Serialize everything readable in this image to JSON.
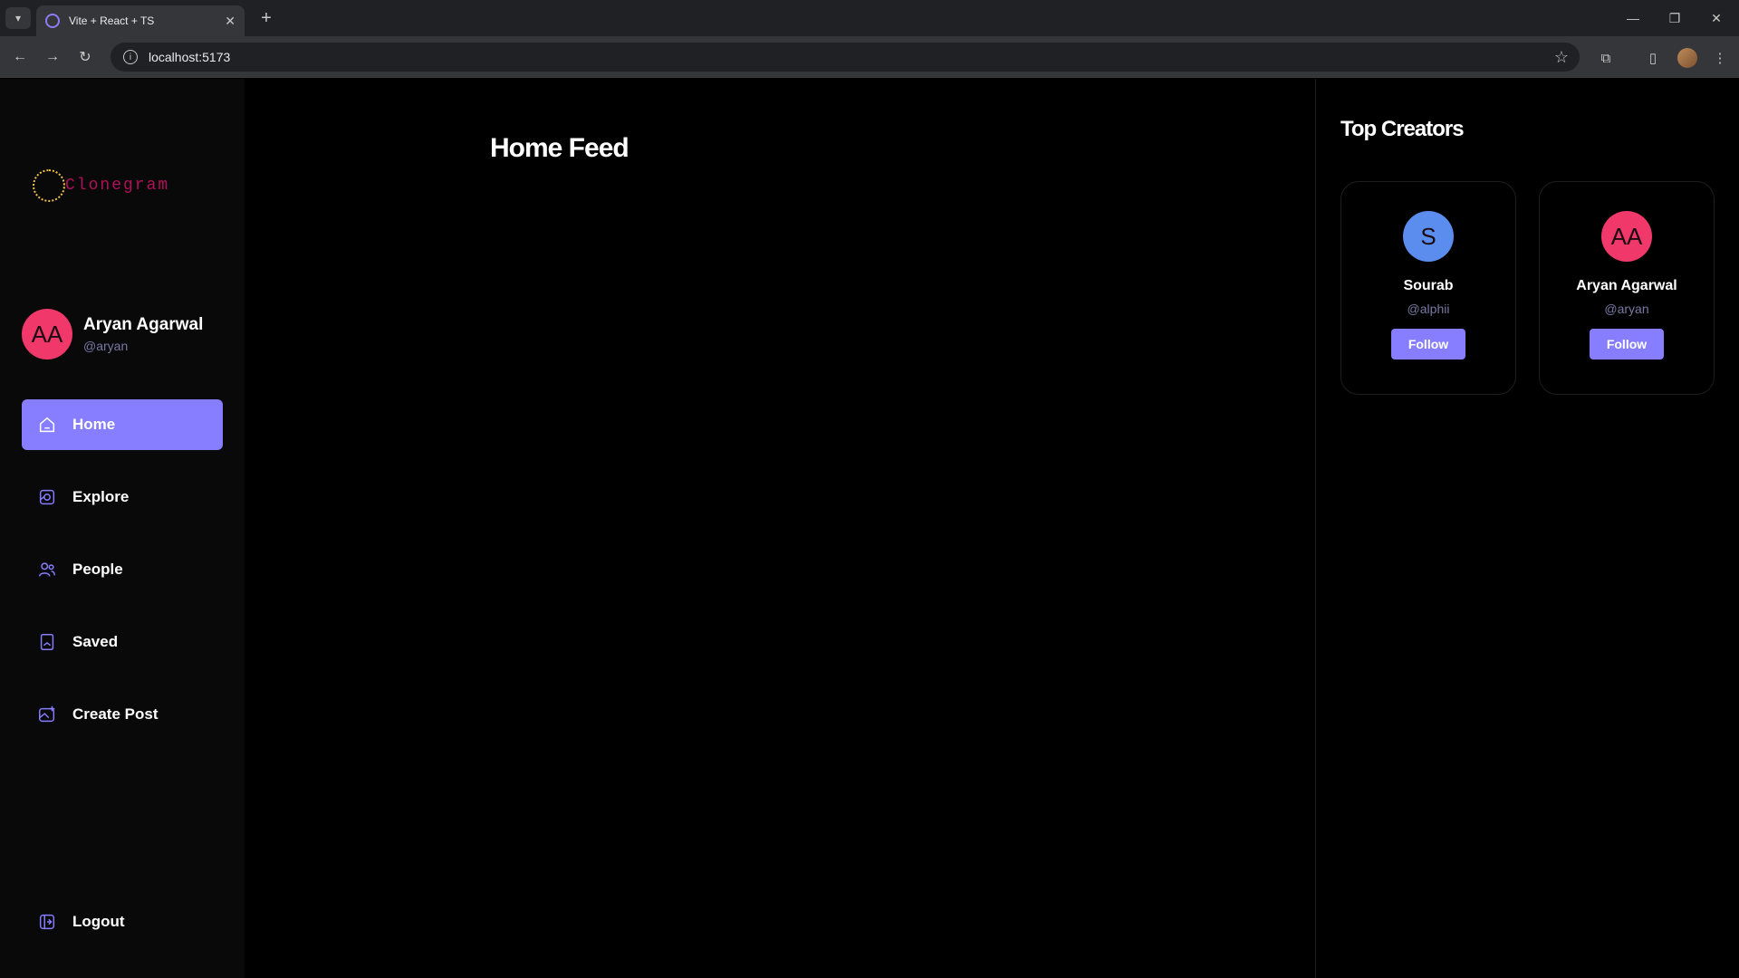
{
  "browser": {
    "tab_title": "Vite + React + TS",
    "url": "localhost:5173",
    "icons": [
      "tab-list-icon",
      "close-icon",
      "plus-icon",
      "back-icon",
      "forward-icon",
      "reload-icon",
      "info-icon",
      "star-icon",
      "extensions-icon",
      "sidepanel-icon",
      "profile-icon",
      "menu-icon",
      "minimize-icon",
      "restore-icon",
      "window-close-icon"
    ]
  },
  "app": {
    "logo_text": "Clonegram",
    "colors": {
      "accent": "#877eff",
      "avatar_pink": "#f0386b",
      "avatar_blue": "#5b8def",
      "muted": "#7878a3",
      "logo_text": "#b0105a"
    }
  },
  "profile": {
    "initials": "AA",
    "name": "Aryan Agarwal",
    "handle": "@aryan"
  },
  "nav": {
    "items": [
      {
        "label": "Home",
        "icon": "home-icon",
        "active": true
      },
      {
        "label": "Explore",
        "icon": "explore-icon",
        "active": false
      },
      {
        "label": "People",
        "icon": "people-icon",
        "active": false
      },
      {
        "label": "Saved",
        "icon": "saved-icon",
        "active": false
      },
      {
        "label": "Create Post",
        "icon": "create-post-icon",
        "active": false
      }
    ],
    "logout_label": "Logout"
  },
  "main": {
    "title": "Home Feed"
  },
  "creators": {
    "title": "Top Creators",
    "items": [
      {
        "initials": "S",
        "name": "Sourab",
        "handle": "@alphii",
        "follow_label": "Follow",
        "avatar_color": "#5b8def"
      },
      {
        "initials": "AA",
        "name": "Aryan Agarwal",
        "handle": "@aryan",
        "follow_label": "Follow",
        "avatar_color": "#f0386b"
      }
    ]
  }
}
